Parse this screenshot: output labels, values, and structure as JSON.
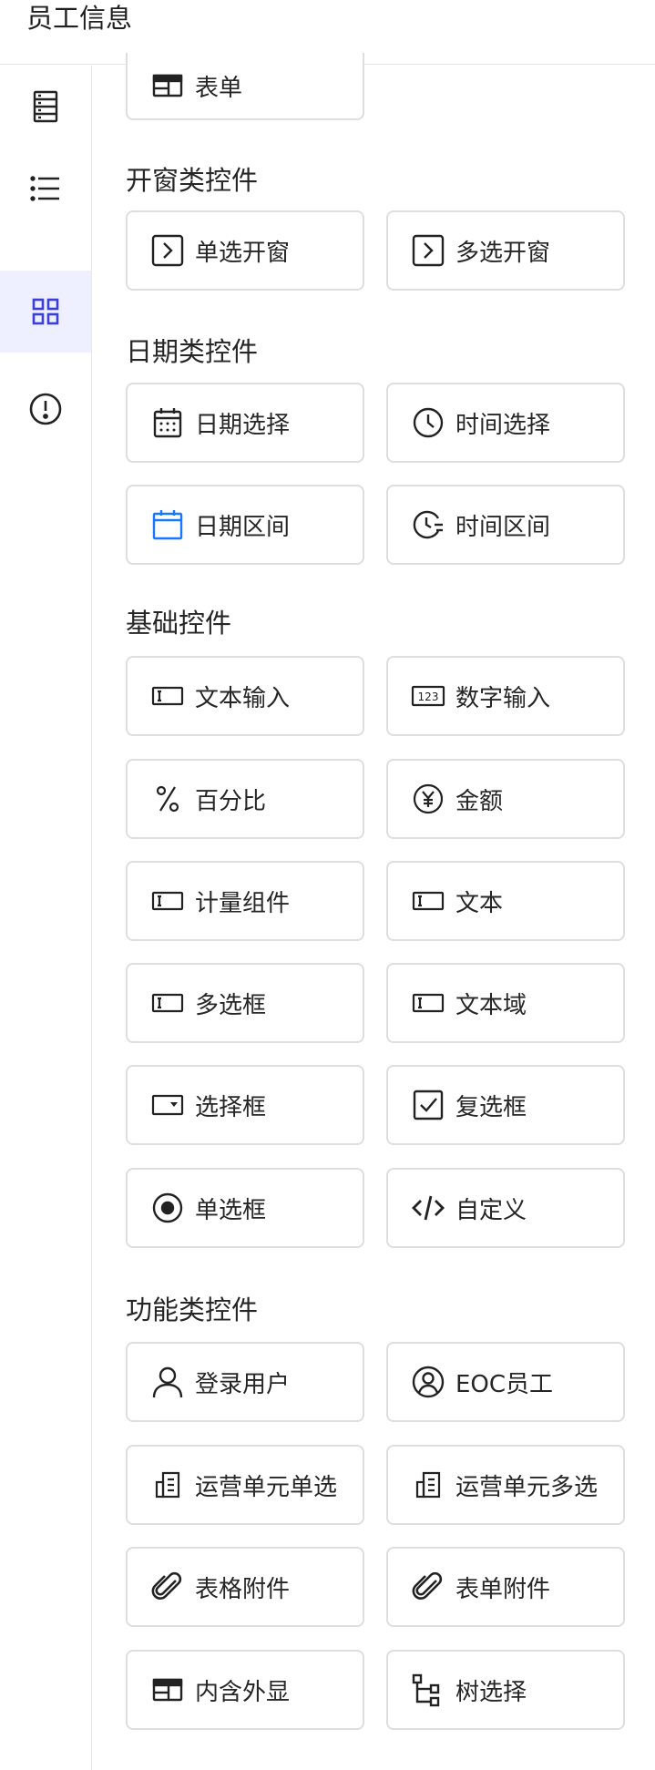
{
  "header": {
    "title": "员工信息"
  },
  "sidebar": {
    "items": [
      {
        "icon": "data-table-icon",
        "active": false
      },
      {
        "icon": "list-icon",
        "active": false
      },
      {
        "icon": "grid-icon",
        "active": true
      },
      {
        "icon": "alert-icon",
        "active": false
      }
    ],
    "active_color": "#3a3fd6"
  },
  "sections": {
    "s0": {
      "items": [
        {
          "label": "表单",
          "icon": "form-icon"
        }
      ]
    },
    "s1": {
      "title": "开窗类控件",
      "items": [
        {
          "label": "单选开窗",
          "icon": "popup-icon"
        },
        {
          "label": "多选开窗",
          "icon": "popup-icon"
        }
      ]
    },
    "s2": {
      "title": "日期类控件",
      "items": [
        {
          "label": "日期选择",
          "icon": "calendar-icon"
        },
        {
          "label": "时间选择",
          "icon": "clock-icon"
        },
        {
          "label": "日期区间",
          "icon": "calendar-range-icon"
        },
        {
          "label": "时间区间",
          "icon": "time-range-icon"
        }
      ]
    },
    "s3": {
      "title": "基础控件",
      "items": [
        {
          "label": "文本输入",
          "icon": "text-input-icon"
        },
        {
          "label": "数字输入",
          "icon": "number-input-icon"
        },
        {
          "label": "百分比",
          "icon": "percent-icon"
        },
        {
          "label": "金额",
          "icon": "yen-icon"
        },
        {
          "label": "计量组件",
          "icon": "text-input-icon"
        },
        {
          "label": "文本",
          "icon": "text-input-icon"
        },
        {
          "label": "多选框",
          "icon": "text-input-icon"
        },
        {
          "label": "文本域",
          "icon": "text-input-icon"
        },
        {
          "label": "选择框",
          "icon": "select-icon"
        },
        {
          "label": "复选框",
          "icon": "checkbox-icon"
        },
        {
          "label": "单选框",
          "icon": "radio-icon"
        },
        {
          "label": "自定义",
          "icon": "code-icon"
        }
      ]
    },
    "s4": {
      "title": "功能类控件",
      "items": [
        {
          "label": "登录用户",
          "icon": "user-icon"
        },
        {
          "label": "EOC员工",
          "icon": "user-circle-icon"
        },
        {
          "label": "运营单元单选",
          "icon": "building-icon"
        },
        {
          "label": "运营单元多选",
          "icon": "building-icon"
        },
        {
          "label": "表格附件",
          "icon": "paperclip-icon"
        },
        {
          "label": "表单附件",
          "icon": "paperclip-icon"
        },
        {
          "label": "内含外显",
          "icon": "form-icon"
        },
        {
          "label": "树选择",
          "icon": "tree-icon"
        }
      ]
    }
  },
  "colors": {
    "accent_blue": "#1677ff",
    "card_border": "#dedede"
  }
}
